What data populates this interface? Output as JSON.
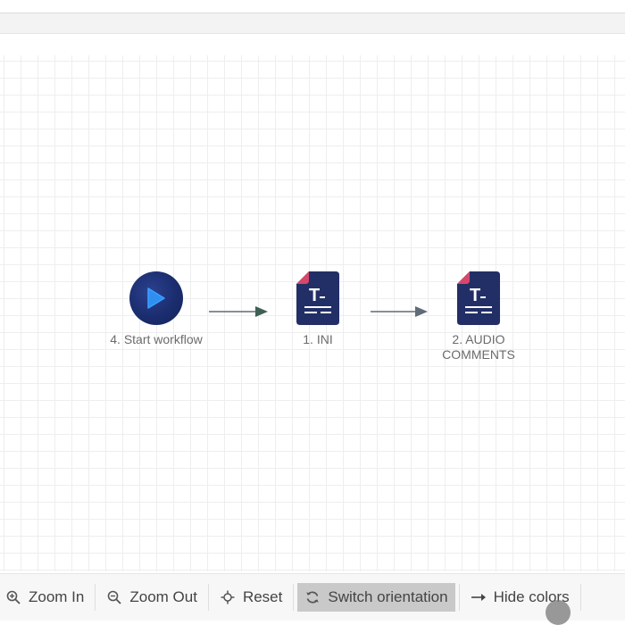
{
  "workflow": {
    "nodes": [
      {
        "id": "start",
        "label": "4. Start workflow",
        "icon": "play-icon"
      },
      {
        "id": "ini",
        "label": "1. INI",
        "icon": "text-document-icon"
      },
      {
        "id": "audio",
        "label": "2. AUDIO COMMENTS",
        "icon": "text-document-icon"
      }
    ]
  },
  "toolbar": {
    "zoom_in": "Zoom In",
    "zoom_out": "Zoom Out",
    "reset": "Reset",
    "switch_orientation": "Switch orientation",
    "hide_colors": "Hide colors"
  },
  "colors": {
    "node_navy": "#1d2e6b",
    "play_blue": "#2f8ff0",
    "doc_corner": "#d6476b",
    "arrow": "#5f6b76",
    "active_button": "#c9c9c9"
  }
}
